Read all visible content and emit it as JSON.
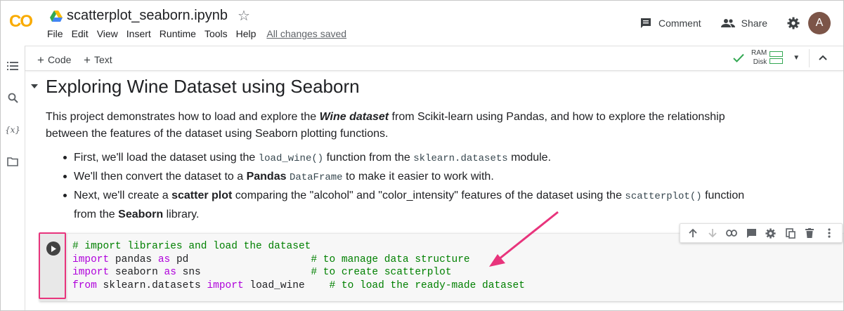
{
  "header": {
    "logo_text": "CO",
    "doc_title": "scatterplot_seaborn.ipynb",
    "menu": [
      "File",
      "Edit",
      "View",
      "Insert",
      "Runtime",
      "Tools",
      "Help"
    ],
    "save_status": "All changes saved",
    "comment_label": "Comment",
    "share_label": "Share",
    "avatar_letter": "A"
  },
  "toolbar": {
    "add_code": "Code",
    "add_text": "Text",
    "ram_label": "RAM",
    "disk_label": "Disk"
  },
  "rail": [
    "toc-icon",
    "search-icon",
    "variables-icon",
    "files-icon"
  ],
  "notebook": {
    "heading": "Exploring Wine Dataset using Seaborn",
    "intro": {
      "t1": "This project demonstrates how to load and explore the ",
      "bold1": "Wine dataset",
      "t2": " from Scikit-learn using Pandas, and how to explore the relationship between the features of the dataset using Seaborn plotting functions."
    },
    "bullets": [
      {
        "t1": "First, we'll load the dataset using the ",
        "c1": "load_wine()",
        "t2": " function from the ",
        "c2": "sklearn.datasets",
        "t3": " module."
      },
      {
        "t1": "We'll then convert the dataset to a ",
        "b1": "Pandas",
        "c1": "DataFrame",
        "t2": " to make it easier to work with."
      },
      {
        "t1": "Next, we'll create a ",
        "b1": "scatter plot",
        "t2": " comparing the \"alcohol\" and \"color_intensity\" features of the dataset using the ",
        "c1": "scatterplot()",
        "t3": " function from the ",
        "b2": "Seaborn",
        "t4": " library."
      }
    ],
    "code_cell": {
      "line1_comment": "# import libraries and load the dataset",
      "line2": {
        "kw1": "import",
        "mod": " pandas ",
        "kw2": "as",
        "alias": " pd",
        "pad": "                    ",
        "comment": "# to manage data structure"
      },
      "line3": {
        "kw1": "import",
        "mod": " seaborn ",
        "kw2": "as",
        "alias": " sns",
        "pad": "                  ",
        "comment": "# to create scatterplot"
      },
      "line4": {
        "kw1": "from",
        "mod": " sklearn.datasets ",
        "kw2": "import",
        "alias": " load_wine",
        "pad": "    ",
        "comment": "# to load the ready-made dataset"
      }
    },
    "cell_toolbar": [
      "move-up-icon",
      "move-down-icon",
      "link-icon",
      "comment-icon",
      "settings-icon",
      "mirror-cell-icon",
      "delete-icon",
      "more-icon"
    ]
  },
  "colors": {
    "accent_pink": "#e8347c",
    "colab_orange": "#f9ab00",
    "ok_green": "#34a853"
  }
}
